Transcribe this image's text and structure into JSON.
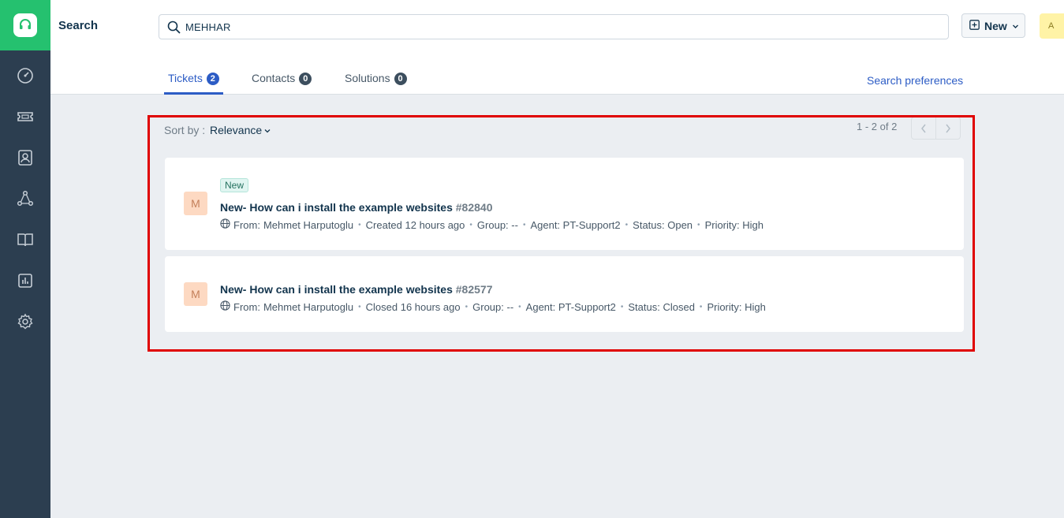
{
  "header": {
    "title": "Search",
    "search_value": "MEHHAR",
    "new_button_label": "New",
    "user_avatar_initial": "A"
  },
  "sidebar": {
    "items": [
      {
        "icon": "dashboard-icon"
      },
      {
        "icon": "ticket-icon"
      },
      {
        "icon": "contacts-icon"
      },
      {
        "icon": "groups-icon"
      },
      {
        "icon": "solutions-book-icon"
      },
      {
        "icon": "reports-icon"
      },
      {
        "icon": "settings-gear-icon"
      }
    ]
  },
  "tabs": [
    {
      "label": "Tickets",
      "count": "2",
      "active": true
    },
    {
      "label": "Contacts",
      "count": "0",
      "active": false
    },
    {
      "label": "Solutions",
      "count": "0",
      "active": false
    }
  ],
  "search_preferences_label": "Search preferences",
  "sort": {
    "label": "Sort by :",
    "value": "Relevance"
  },
  "pagination": {
    "text": "1 - 2 of 2"
  },
  "results": [
    {
      "avatar": "M",
      "badge": "New",
      "title": "New- How can i install the example websites",
      "id": "#82840",
      "from_label": "From:",
      "from": "Mehmet Harputoglu",
      "time": "Created 12 hours ago",
      "group": "Group: --",
      "agent": "Agent: PT-Support2",
      "status": "Status: Open",
      "priority": "Priority: High"
    },
    {
      "avatar": "M",
      "badge": "",
      "title": "New- How can i install the example websites",
      "id": "#82577",
      "from_label": "From:",
      "from": "Mehmet Harputoglu",
      "time": "Closed 16 hours ago",
      "group": "Group: --",
      "agent": "Agent: PT-Support2",
      "status": "Status: Closed",
      "priority": "Priority: High"
    }
  ],
  "colors": {
    "brand_green": "#25c16f",
    "sidebar": "#2c3e50",
    "link_blue": "#2c5cc5",
    "highlight_red": "#e00000"
  }
}
